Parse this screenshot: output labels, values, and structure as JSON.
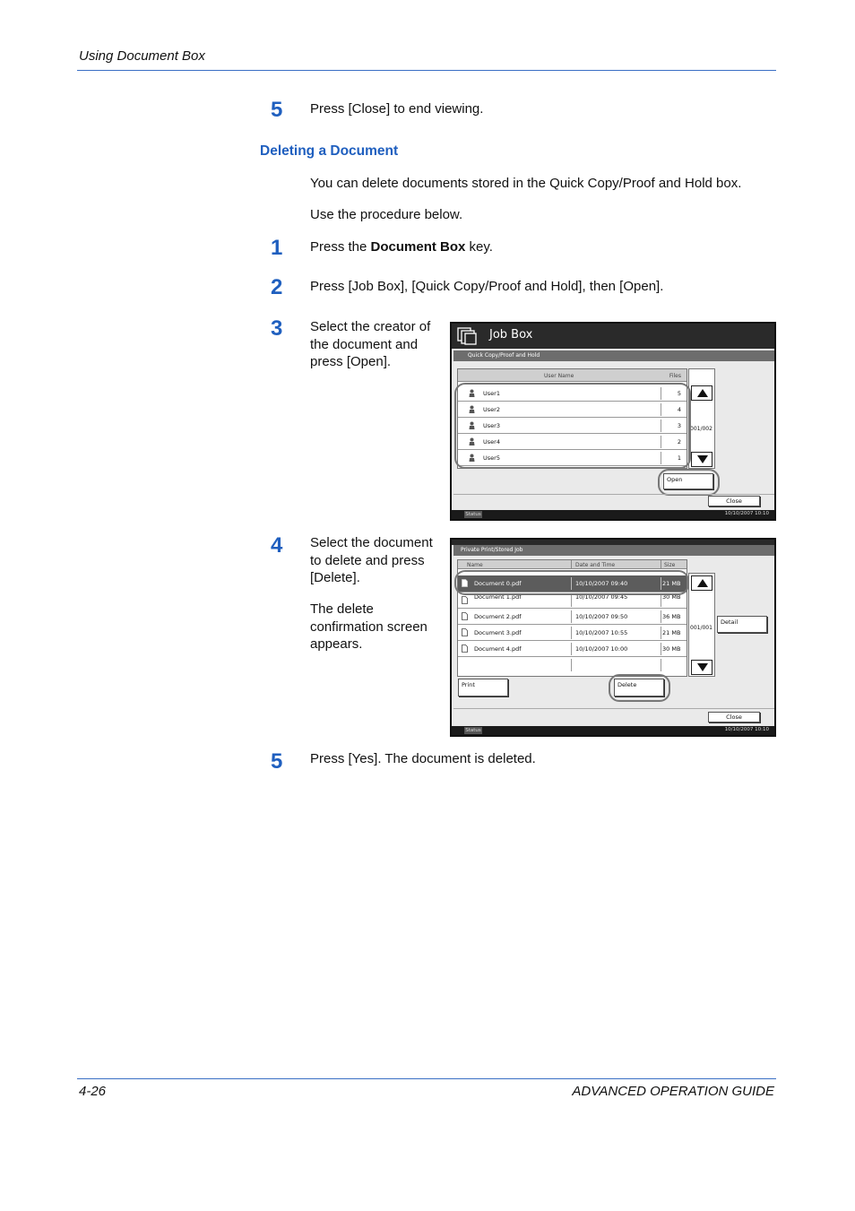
{
  "header": {
    "title": "Using Document Box"
  },
  "step5a": {
    "num": "5",
    "text": "Press [Close] to end viewing."
  },
  "section": {
    "title": "Deleting a Document"
  },
  "intro": {
    "p1": "You can delete documents stored in the Quick Copy/Proof and Hold box.",
    "p2": "Use the procedure below."
  },
  "step1": {
    "num": "1",
    "pre": "Press the ",
    "bold": "Document Box",
    "post": " key."
  },
  "step2": {
    "num": "2",
    "text": "Press [Job Box], [Quick Copy/Proof and Hold], then [Open]."
  },
  "step3": {
    "num": "3",
    "line1": "Select the creator of",
    "line2": "the document and",
    "line3": "press [Open]."
  },
  "step4": {
    "num": "4",
    "line1": "Select the document",
    "line2": "to delete and press",
    "line3": "[Delete].",
    "note1": "The delete",
    "note2": "confirmation screen",
    "note3": "appears."
  },
  "step5b": {
    "num": "5",
    "text": "Press [Yes]. The document is deleted."
  },
  "footer": {
    "page": "4-26",
    "guide": "ADVANCED OPERATION GUIDE"
  },
  "screen1": {
    "title": "Job Box",
    "subtitle": "Quick Copy/Proof and Hold",
    "col_user": "User Name",
    "col_files": "Files",
    "rows": [
      {
        "user": "User1",
        "files": "5"
      },
      {
        "user": "User2",
        "files": "4"
      },
      {
        "user": "User3",
        "files": "3"
      },
      {
        "user": "User4",
        "files": "2"
      },
      {
        "user": "User5",
        "files": "1"
      }
    ],
    "page": "001/002",
    "open": "Open",
    "close": "Close",
    "status": "Status",
    "datetime": "10/10/2007   10:10"
  },
  "screen2": {
    "subtitle": "Private Print/Stored Job",
    "col_name": "Name",
    "col_date": "Date and Time",
    "col_size": "Size",
    "rows": [
      {
        "name": "Document 0.pdf",
        "date": "10/10/2007 09:40",
        "size": "21 MB"
      },
      {
        "name": "Document 1.pdf",
        "date": "10/10/2007 09:45",
        "size": "30 MB"
      },
      {
        "name": "Document 2.pdf",
        "date": "10/10/2007 09:50",
        "size": "36 MB"
      },
      {
        "name": "Document 3.pdf",
        "date": "10/10/2007 10:55",
        "size": "21 MB"
      },
      {
        "name": "Document 4.pdf",
        "date": "10/10/2007 10:00",
        "size": "30 MB"
      }
    ],
    "page": "001/001",
    "detail": "Detail",
    "print": "Print",
    "delete": "Delete",
    "close": "Close",
    "status": "Status",
    "datetime": "10/10/2007   10:10"
  },
  "colors": {
    "accent": "#1f5fbf",
    "rule": "#3a6fc4",
    "selected_row": "#5c5c5c"
  },
  "icons": [
    "job-box-icon",
    "user-icon",
    "document-icon",
    "up-arrow-icon",
    "down-arrow-icon"
  ]
}
